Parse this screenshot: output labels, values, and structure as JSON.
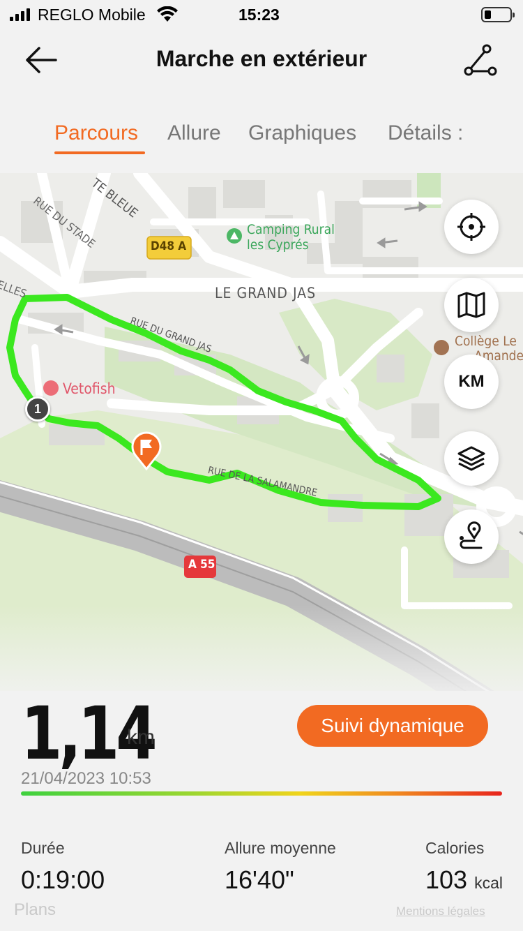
{
  "status_bar": {
    "carrier": "REGLO Mobile",
    "time": "15:23"
  },
  "header": {
    "title": "Marche en extérieur"
  },
  "tabs": [
    {
      "label": "Parcours",
      "active": true
    },
    {
      "label": "Allure",
      "active": false
    },
    {
      "label": "Graphiques",
      "active": false
    },
    {
      "label": "Détails :",
      "active": false
    }
  ],
  "map": {
    "labels": {
      "rue_du_stade": "RUE DU STADE",
      "te_bleue": "TE BLEUE",
      "road_d48a": "D48 A",
      "camping": "Camping Rural",
      "camping_line2": "les Cyprés",
      "elles": "ELLES",
      "le_grand_jas": "LE GRAND JAS",
      "rue_du_grand_jas": "RUE DU GRAND JAS",
      "college": "Collège Le",
      "college_line2": "Amandeir",
      "vetofish": "Vetofish",
      "rue_salamandre": "RUE DE LA SALAMANDRE",
      "road_a55": "A 55"
    },
    "km_button": "KM",
    "start_marker": "1",
    "route_color": "#3be81f",
    "accent_color": "#f26a22"
  },
  "summary": {
    "distance": "1,14",
    "distance_unit": "km",
    "date": "21/04/2023 10:53",
    "follow_button": "Suivi dynamique"
  },
  "stats": [
    {
      "label": "Durée",
      "value": "0:19:00",
      "unit": ""
    },
    {
      "label": "Allure moyenne",
      "value": "16'40\"",
      "unit": ""
    },
    {
      "label": "Calories",
      "value": "103",
      "unit": "kcal"
    }
  ],
  "footer": {
    "maps_watermark": "Plans",
    "legal": "Mentions légales"
  }
}
